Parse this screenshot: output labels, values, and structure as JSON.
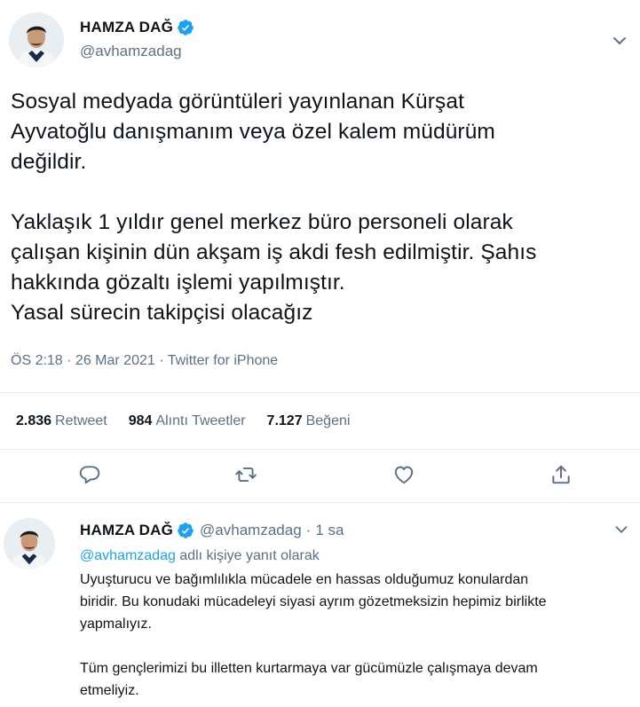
{
  "colors": {
    "accent": "#1da1f2",
    "secondary_text": "#5b7083",
    "primary_text": "#0f1419",
    "divider": "#e6ecf0"
  },
  "tweet": {
    "author": {
      "name": "HAMZA DAĞ",
      "handle": "@avhamzadag",
      "verified": true,
      "avatar_icon": "avatar-photo"
    },
    "paragraphs": [
      [
        "Sosyal medyada görüntüleri yayınlanan Kürşat",
        "Ayvatoğlu danışmanım veya özel kalem müdürüm",
        "değildir."
      ],
      [
        "Yaklaşık 1 yıldır genel merkez büro personeli olarak",
        "çalışan kişinin dün akşam iş akdi fesh edilmiştir. Şahıs",
        "hakkında gözaltı işlemi yapılmıştır.",
        "Yasal sürecin takipçisi olacağız"
      ]
    ],
    "meta": "ÖS 2:18 · 26 Mar 2021 · Twitter for iPhone",
    "stats": {
      "retweets": {
        "count": "2.836",
        "label": "Retweet"
      },
      "quotes": {
        "count": "984",
        "label": "Alıntı Tweetler"
      },
      "likes": {
        "count": "7.127",
        "label": "Beğeni"
      }
    },
    "actions": [
      "reply-icon",
      "retweet-icon",
      "like-icon",
      "share-icon"
    ]
  },
  "reply": {
    "author": {
      "name": "HAMZA DAĞ",
      "handle": "@avhamzadag",
      "verified": true
    },
    "separator": "·",
    "time": "1 sa",
    "replying_mention": "@avhamzadag",
    "replying_suffix": " adlı kişiye yanıt olarak",
    "paragraphs": [
      [
        "Uyuşturucu ve bağımlılıkla mücadele en hassas olduğumuz konulardan",
        "biridir. Bu konudaki mücadeleyi siyasi ayrım gözetmeksizin hepimiz birlikte",
        "yapmalıyız."
      ],
      [
        "Tüm gençlerimizi bu illetten kurtarmaya var gücümüzle çalışmaya devam",
        "etmeliyiz."
      ]
    ]
  }
}
